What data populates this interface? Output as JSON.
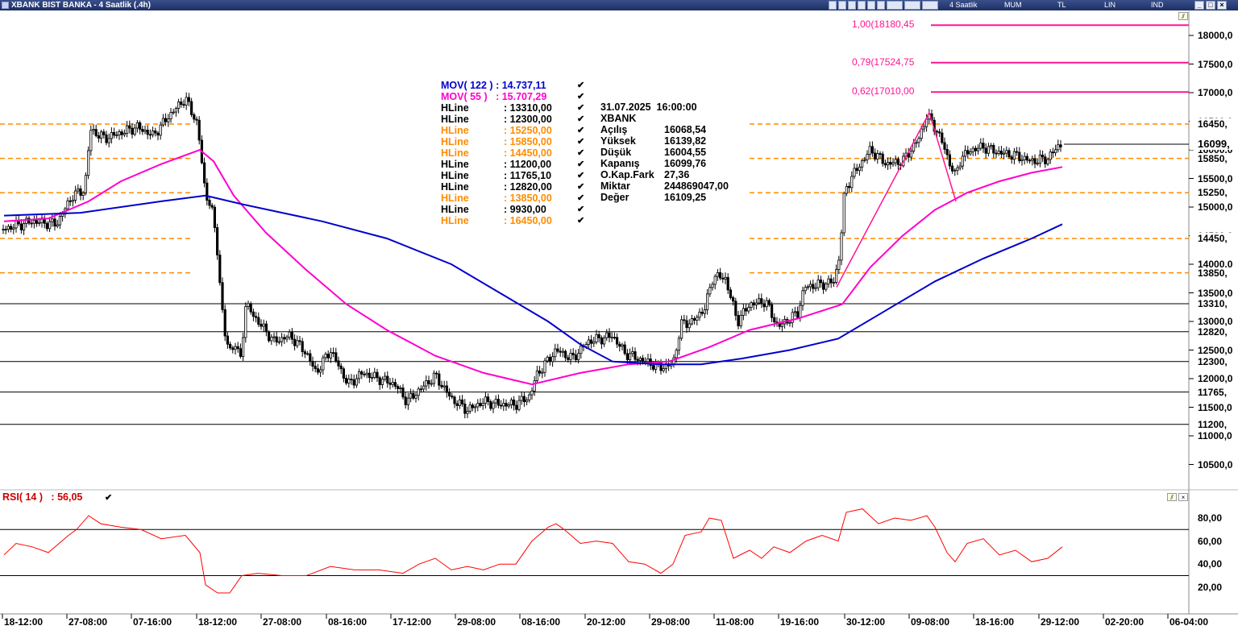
{
  "window": {
    "title": "XBANK BIST BANKA - 4 Saatlik (.4h)",
    "toolbar": [
      "4 Saatlik",
      "MUM",
      "TL",
      "LIN",
      "IND"
    ]
  },
  "legend": {
    "mov122": "MOV( 122 ) : 14.737,11",
    "mov55": "MOV( 55 )   : 15.707,29",
    "hlines": [
      {
        "label": "HLine",
        "value": ": 13310,00",
        "color": "#000000"
      },
      {
        "label": "HLine",
        "value": ": 12300,00",
        "color": "#000000"
      },
      {
        "label": "HLine",
        "value": ": 15250,00",
        "color": "#ff8c00"
      },
      {
        "label": "HLine",
        "value": ": 15850,00",
        "color": "#ff8c00"
      },
      {
        "label": "HLine",
        "value": ": 14450,00",
        "color": "#ff8c00"
      },
      {
        "label": "HLine",
        "value": ": 11200,00",
        "color": "#000000"
      },
      {
        "label": "HLine",
        "value": ": 11765,10",
        "color": "#000000"
      },
      {
        "label": "HLine",
        "value": ": 12820,00",
        "color": "#000000"
      },
      {
        "label": "HLine",
        "value": ": 13850,00",
        "color": "#ff8c00"
      },
      {
        "label": "HLine",
        "value": ": 9930,00",
        "color": "#000000"
      },
      {
        "label": "HLine",
        "value": ": 16450,00",
        "color": "#ff8c00"
      }
    ]
  },
  "bar_info": {
    "datetime": "31.07.2025  16:00:00",
    "symbol": "XBANK",
    "rows": [
      {
        "k": "Açılış",
        "v": "16068,54"
      },
      {
        "k": "Yüksek",
        "v": "16139,82"
      },
      {
        "k": "Düşük",
        "v": "16004,55"
      },
      {
        "k": "Kapanış",
        "v": "16099,76"
      },
      {
        "k": "O.Kap.Fark",
        "v": "27,36"
      },
      {
        "k": "Miktar",
        "v": "244869047,00"
      },
      {
        "k": "Değer",
        "v": "16109,25"
      }
    ]
  },
  "fib": [
    {
      "label": "1,00(18180,45",
      "value": 18180.45
    },
    {
      "label": "0,79(17524,75",
      "value": 17524.75
    },
    {
      "label": "0,62(17010,00",
      "value": 17010.0
    }
  ],
  "price_labels": [
    {
      "text": "16450,",
      "value": 16450,
      "color": "#000"
    },
    {
      "text": "16099,",
      "value": 16099,
      "color": "#000"
    },
    {
      "text": "15850,",
      "value": 15850,
      "color": "#000"
    },
    {
      "text": "15250,",
      "value": 15250,
      "color": "#000"
    },
    {
      "text": "14450,",
      "value": 14450,
      "color": "#000"
    },
    {
      "text": "13850,",
      "value": 13850,
      "color": "#000"
    },
    {
      "text": "13310,",
      "value": 13310,
      "color": "#000"
    },
    {
      "text": "12820,",
      "value": 12820,
      "color": "#000"
    },
    {
      "text": "12300,",
      "value": 12300,
      "color": "#000"
    },
    {
      "text": "11765,",
      "value": 11765,
      "color": "#000"
    },
    {
      "text": "11200,",
      "value": 11200,
      "color": "#000"
    }
  ],
  "rsi": {
    "label": "RSI( 14 )   : 56,05",
    "ticks": [
      "80,00",
      "60,00",
      "40,00",
      "20,00"
    ]
  },
  "colors": {
    "mov122": "#0000cc",
    "mov55": "#ff00cc",
    "orange": "#ff8c00",
    "rsi": "#ff0000",
    "fib": "#ff1493"
  },
  "chart_data": {
    "type": "candlestick",
    "y_ticks": [
      "18000,0",
      "17500,0",
      "17000,0",
      "16500,0",
      "16000,0",
      "15500,0",
      "15000,0",
      "14500,0",
      "14000,0",
      "13500,0",
      "13000,0",
      "12500,0",
      "12000,0",
      "11500,0",
      "11000,0",
      "10500,0"
    ],
    "x_ticks": [
      "18-12:00",
      "27-08:00",
      "07-16:00",
      "18-12:00",
      "27-08:00",
      "08-16:00",
      "17-12:00",
      "29-08:00",
      "08-16:00",
      "20-12:00",
      "29-08:00",
      "11-08:00",
      "19-16:00",
      "30-12:00",
      "09-08:00",
      "18-16:00",
      "29-12:00",
      "02-20:00",
      "06-04:00"
    ],
    "close_path": [
      [
        0,
        14600
      ],
      [
        40,
        14750
      ],
      [
        70,
        14700
      ],
      [
        90,
        15200
      ],
      [
        105,
        15300
      ],
      [
        112,
        16350
      ],
      [
        130,
        16200
      ],
      [
        150,
        16300
      ],
      [
        170,
        16400
      ],
      [
        190,
        16250
      ],
      [
        210,
        16600
      ],
      [
        230,
        16900
      ],
      [
        245,
        16450
      ],
      [
        255,
        15200
      ],
      [
        262,
        15050
      ],
      [
        270,
        14200
      ],
      [
        278,
        12800
      ],
      [
        285,
        12500
      ],
      [
        292,
        12600
      ],
      [
        298,
        12300
      ],
      [
        305,
        13300
      ],
      [
        320,
        13000
      ],
      [
        340,
        12650
      ],
      [
        360,
        12750
      ],
      [
        380,
        12450
      ],
      [
        392,
        12100
      ],
      [
        410,
        12500
      ],
      [
        432,
        11900
      ],
      [
        450,
        12100
      ],
      [
        470,
        12000
      ],
      [
        490,
        11900
      ],
      [
        505,
        11600
      ],
      [
        520,
        11800
      ],
      [
        540,
        12050
      ],
      [
        560,
        11650
      ],
      [
        580,
        11450
      ],
      [
        600,
        11600
      ],
      [
        620,
        11550
      ],
      [
        640,
        11550
      ],
      [
        658,
        11700
      ],
      [
        665,
        12050
      ],
      [
        690,
        12500
      ],
      [
        710,
        12350
      ],
      [
        730,
        12650
      ],
      [
        760,
        12750
      ],
      [
        775,
        12450
      ],
      [
        800,
        12300
      ],
      [
        820,
        12200
      ],
      [
        835,
        12250
      ],
      [
        845,
        12950
      ],
      [
        860,
        13000
      ],
      [
        875,
        13250
      ],
      [
        885,
        13800
      ],
      [
        900,
        13750
      ],
      [
        915,
        13000
      ],
      [
        930,
        13300
      ],
      [
        950,
        13350
      ],
      [
        965,
        12900
      ],
      [
        990,
        13150
      ],
      [
        998,
        13600
      ],
      [
        1020,
        13650
      ],
      [
        1035,
        13700
      ],
      [
        1042,
        14200
      ],
      [
        1048,
        15300
      ],
      [
        1060,
        15600
      ],
      [
        1080,
        16000
      ],
      [
        1100,
        15750
      ],
      [
        1120,
        15800
      ],
      [
        1140,
        16200
      ],
      [
        1150,
        16600
      ],
      [
        1160,
        16400
      ],
      [
        1170,
        16100
      ],
      [
        1180,
        15700
      ],
      [
        1185,
        15550
      ],
      [
        1192,
        15850
      ],
      [
        1205,
        16000
      ],
      [
        1220,
        16050
      ],
      [
        1240,
        15950
      ],
      [
        1260,
        15900
      ],
      [
        1280,
        15800
      ],
      [
        1300,
        15850
      ],
      [
        1315,
        16100
      ]
    ],
    "mov55_path": [
      [
        5,
        14750
      ],
      [
        60,
        14800
      ],
      [
        110,
        15100
      ],
      [
        150,
        15450
      ],
      [
        200,
        15750
      ],
      [
        248,
        16000
      ],
      [
        265,
        15800
      ],
      [
        290,
        15200
      ],
      [
        330,
        14550
      ],
      [
        380,
        13900
      ],
      [
        430,
        13300
      ],
      [
        480,
        12850
      ],
      [
        540,
        12400
      ],
      [
        600,
        12100
      ],
      [
        660,
        11900
      ],
      [
        720,
        12100
      ],
      [
        780,
        12250
      ],
      [
        830,
        12300
      ],
      [
        880,
        12550
      ],
      [
        930,
        12850
      ],
      [
        990,
        13050
      ],
      [
        1045,
        13300
      ],
      [
        1080,
        13950
      ],
      [
        1120,
        14500
      ],
      [
        1160,
        14950
      ],
      [
        1200,
        15250
      ],
      [
        1240,
        15450
      ],
      [
        1280,
        15600
      ],
      [
        1318,
        15700
      ]
    ],
    "mov122_path": [
      [
        5,
        14850
      ],
      [
        100,
        14900
      ],
      [
        200,
        15100
      ],
      [
        255,
        15200
      ],
      [
        300,
        15050
      ],
      [
        400,
        14750
      ],
      [
        480,
        14450
      ],
      [
        560,
        14000
      ],
      [
        620,
        13500
      ],
      [
        680,
        13000
      ],
      [
        720,
        12600
      ],
      [
        760,
        12300
      ],
      [
        820,
        12250
      ],
      [
        870,
        12250
      ],
      [
        920,
        12350
      ],
      [
        980,
        12500
      ],
      [
        1040,
        12700
      ],
      [
        1100,
        13200
      ],
      [
        1160,
        13700
      ],
      [
        1220,
        14100
      ],
      [
        1280,
        14450
      ],
      [
        1318,
        14700
      ]
    ],
    "zigzag": [
      [
        1038,
        13600
      ],
      [
        1153,
        16650
      ],
      [
        1186,
        15100
      ]
    ],
    "rsi_path": [
      [
        5,
        48
      ],
      [
        20,
        58
      ],
      [
        40,
        55
      ],
      [
        60,
        50
      ],
      [
        85,
        65
      ],
      [
        95,
        70
      ],
      [
        110,
        82
      ],
      [
        125,
        75
      ],
      [
        150,
        72
      ],
      [
        175,
        70
      ],
      [
        200,
        62
      ],
      [
        230,
        65
      ],
      [
        248,
        50
      ],
      [
        255,
        22
      ],
      [
        270,
        15
      ],
      [
        285,
        15
      ],
      [
        300,
        30
      ],
      [
        320,
        32
      ],
      [
        350,
        30
      ],
      [
        380,
        30
      ],
      [
        410,
        38
      ],
      [
        440,
        35
      ],
      [
        470,
        35
      ],
      [
        500,
        32
      ],
      [
        520,
        40
      ],
      [
        540,
        45
      ],
      [
        560,
        35
      ],
      [
        580,
        38
      ],
      [
        600,
        35
      ],
      [
        620,
        40
      ],
      [
        640,
        40
      ],
      [
        660,
        60
      ],
      [
        680,
        72
      ],
      [
        690,
        75
      ],
      [
        700,
        70
      ],
      [
        720,
        58
      ],
      [
        740,
        60
      ],
      [
        760,
        58
      ],
      [
        780,
        42
      ],
      [
        800,
        40
      ],
      [
        820,
        32
      ],
      [
        835,
        40
      ],
      [
        850,
        65
      ],
      [
        870,
        68
      ],
      [
        880,
        80
      ],
      [
        895,
        78
      ],
      [
        910,
        45
      ],
      [
        930,
        52
      ],
      [
        945,
        45
      ],
      [
        960,
        55
      ],
      [
        980,
        50
      ],
      [
        1000,
        60
      ],
      [
        1020,
        65
      ],
      [
        1040,
        60
      ],
      [
        1050,
        85
      ],
      [
        1070,
        88
      ],
      [
        1090,
        75
      ],
      [
        1110,
        80
      ],
      [
        1130,
        78
      ],
      [
        1150,
        82
      ],
      [
        1160,
        72
      ],
      [
        1175,
        50
      ],
      [
        1185,
        42
      ],
      [
        1200,
        58
      ],
      [
        1220,
        62
      ],
      [
        1240,
        48
      ],
      [
        1260,
        52
      ],
      [
        1280,
        42
      ],
      [
        1300,
        45
      ],
      [
        1318,
        55
      ]
    ]
  }
}
